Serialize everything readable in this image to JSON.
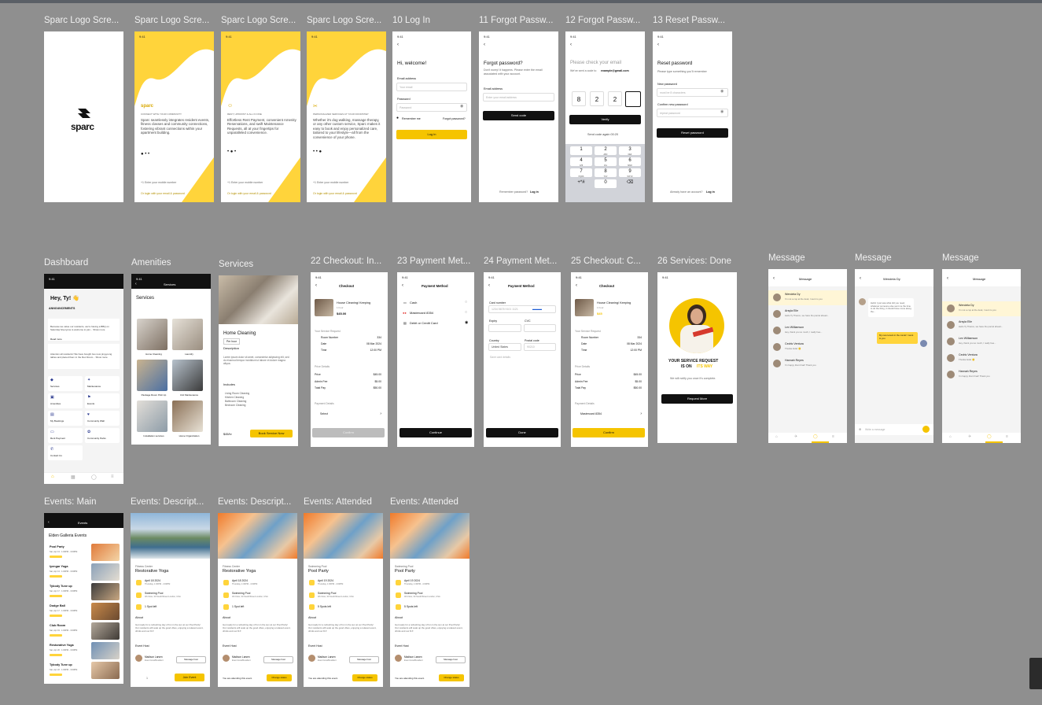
{
  "frames": {
    "splash": {
      "label": "Sparc Logo Scre...",
      "logo": "sparc"
    },
    "onboard1": {
      "label": "Sparc Logo Scre...",
      "brand": "sparc",
      "kicker": "CONNECT WITH YOUR COMMUNITY",
      "text": "Sparc seamlessly integrates resident events, fitness classes and community connections, fostering vibrant connections within your apartment building.",
      "phone": "+1  Enter your mobile number",
      "alt": "Or login with your email & password"
    },
    "onboard2": {
      "label": "Sparc Logo Scre...",
      "kicker": "RENT, UPFRONT & ALL IN ONE",
      "text": "Effortless Rent Payment, convenient Amenity Reservations, and swift Maintenance Requests, all at your fingertips for unparalleled convenience.",
      "phone": "+1  Enter your mobile number",
      "alt": "Or login with your email & password"
    },
    "onboard3": {
      "label": "Sparc Logo Scre...",
      "kicker": "PERSONALIZED SERVICES AT YOUR DOORSTEP",
      "text": "Whether it's dog walking, massage therapy, or any other custom service, Sparc makes it easy to book and enjoy personalized care, tailored to your lifestyle—all from the convenience of your phone.",
      "phone": "+1  Enter your mobile number",
      "alt": "Or login with your email & password"
    },
    "login": {
      "label": "10 Log In",
      "title": "Hi, welcome!",
      "email_label": "Email address",
      "email_ph": "Your email",
      "pw_label": "Password",
      "pw_ph": "Password",
      "remember": "Remember me",
      "forgot": "Forgot password?",
      "button": "Log in"
    },
    "forgot1": {
      "label": "11 Forgot Passw...",
      "title": "Forgot password?",
      "sub": "Don't worry! It happens. Please enter the email associated with your account.",
      "email_label": "Email address",
      "email_ph": "Enter your email address",
      "button": "Send code",
      "footer": "Remember password?",
      "footer_link": "Log in"
    },
    "forgot2": {
      "label": "12 Forgot Passw...",
      "title": "Please check your email",
      "sub": "We've sent a code to",
      "email": "example@gmail.com",
      "digits": [
        "8",
        "2",
        "2",
        ""
      ],
      "button": "Verify",
      "resend": "Send code again  00:20",
      "keys": [
        [
          "1",
          ""
        ],
        [
          "2",
          "ABC"
        ],
        [
          "3",
          "DEF"
        ],
        [
          "4",
          "GHI"
        ],
        [
          "5",
          "JKL"
        ],
        [
          "6",
          "MNO"
        ],
        [
          "7",
          "PQRS"
        ],
        [
          "8",
          "TUV"
        ],
        [
          "9",
          "WXYZ"
        ],
        [
          "+*#",
          ""
        ],
        [
          "0",
          ""
        ],
        [
          "⌫",
          ""
        ]
      ]
    },
    "reset": {
      "label": "13 Reset Passw...",
      "title": "Reset password",
      "sub": "Please type something you'll remember",
      "new_label": "New password",
      "new_ph": "must be 8 characters",
      "confirm_label": "Confirm new password",
      "confirm_ph": "repeat password",
      "button": "Reset password",
      "footer": "Already have an account?",
      "footer_link": "Log in"
    },
    "dashboard": {
      "label": "Dashboard",
      "greeting": "Hey, Ty! 👋",
      "section": "ANNOUNCEMENTS",
      "post1": "Because we value our residents, we're having a BBQ on Saturday! Everyone is welcome to join... Show more",
      "post1_tag": "Read more",
      "post2": "Attention all residents! We have bought two new ping-pong tables and placed them in the Rec Room... Show more",
      "tiles": [
        "Services",
        "Maintenance",
        "Amenities",
        "Events",
        "My Bookings",
        "Community Wall",
        "Rent Payment",
        "Community Perks",
        "Contact Us"
      ]
    },
    "amenities": {
      "label": "Amenities",
      "header": "Services",
      "title": "Services",
      "items": [
        "Home Cleaning",
        "Laundry",
        "Package Room Pick Up",
        "Unit Maintenance",
        "Installation services",
        "Home Organization"
      ]
    },
    "services": {
      "label": "Services",
      "title": "Home Cleaning",
      "chip": "Per hour",
      "desc_h": "Description",
      "desc": "Lorem ipsum dolor sit amet, consectetur adipiscing elit, sed do eiusmod tempor incididunt ut labore et dolore magna aliqua.",
      "incl_h": "Includes",
      "incl": [
        "Living Room Cleaning",
        "Kitchen Cleaning",
        "Bathroom Cleaning",
        "Bedroom Cleaning"
      ],
      "price": "$45/hr",
      "button": "Book Service Now"
    },
    "checkout1": {
      "label": "22 Checkout: In...",
      "title": "Checkout",
      "item": "House Cleaning/ Keeping",
      "item_sub": "1 hour",
      "price": "$45.00",
      "req": "Your Service Request",
      "rows": [
        [
          "Room Number",
          "334"
        ],
        [
          "Date",
          "08 Mar 2024"
        ],
        [
          "Time",
          "12:00 PM"
        ]
      ],
      "pd": "Price Details",
      "prices": [
        [
          "Price",
          "$45.00"
        ],
        [
          "Admin Fee",
          "$5.00"
        ],
        [
          "Total Pay",
          "$50.00"
        ]
      ],
      "pay_h": "Payment Details",
      "pay": "Select",
      "button": "Confirm"
    },
    "payment1": {
      "label": "23 Payment Met...",
      "title": "Payment Method",
      "opts": [
        "Cash",
        "Mastercard 8354",
        "Debit or Credit Card"
      ],
      "button": "Continue"
    },
    "payment2": {
      "label": "24 Payment Met...",
      "title": "Payment Method",
      "card_label": "Card number",
      "card_ph": "1234 5678 9101 1121",
      "exp": "Expiry",
      "cvc": "CVC",
      "country": "Country",
      "country_val": "United States",
      "zip": "Postal code",
      "zip_ph": "90210",
      "save": "Save card details",
      "button": "Done"
    },
    "checkout2": {
      "label": "25 Checkout: C...",
      "title": "Checkout",
      "item": "House Cleaning/ Keeping",
      "item_sub": "1 hour",
      "price": "$45",
      "req": "Your Service Request",
      "rows": [
        [
          "Room Number",
          "334"
        ],
        [
          "Date",
          "08 Mar 2024"
        ],
        [
          "Time",
          "12:00 PM"
        ]
      ],
      "pd": "Price Details",
      "prices": [
        [
          "Price",
          "$45.00"
        ],
        [
          "Admin Fee",
          "$5.00"
        ],
        [
          "Total Pay",
          "$50.00"
        ]
      ],
      "pay_h": "Payment Details",
      "pay": "Mastercard 8354",
      "button": "Confirm"
    },
    "done": {
      "label": "26 Services: Done",
      "line1": "YOUR SERVICE REQUEST",
      "line2a": "IS ON ",
      "line2b": "ITS WAY",
      "sub": "We will notify you once it's complete.",
      "button": "Request More"
    },
    "msg1": {
      "label": "Message",
      "title": "Message",
      "threads": [
        [
          "Wendela Dy",
          "I'm not a cop at the desk, I went to you"
        ],
        [
          "Arsyla Elle",
          "Hello Ty Thanco, we have the parcel ahead..."
        ],
        [
          "Lex Williamson",
          "Hey, thank you so much, I really hea..."
        ],
        [
          "Cedric Ventura",
          "Thanks Aida! 🙂"
        ],
        [
          "Hannah Reyes",
          "I'm happy that it had! Thank you"
        ]
      ]
    },
    "msg2": {
      "label": "Message",
      "title": "Wendela Dy",
      "in": "Hello! I just saw what did you need, whatever someone else sent me the time to do the thing, it should have come along the...",
      "out": "My new tenant in the condo! I went to you",
      "input_ph": "Write a message"
    },
    "msg3": {
      "label": "Message",
      "title": "Message",
      "threads": [
        [
          "Wendela Dy",
          "I'm not a cop at the desk, I went to you"
        ],
        [
          "Arsyla Elle",
          "Hello Ty Thanco, we have the parcel ahead..."
        ],
        [
          "Lex Williamson",
          "Hey, thank you so much, I really hea..."
        ],
        [
          "Cedric Ventura",
          "Thanks Aida! 🙂"
        ],
        [
          "Hannah Reyes",
          "I'm happy that it had! Thank you"
        ]
      ]
    },
    "events": {
      "label": "Events: Main",
      "title": "Events",
      "h": "Elden Galleria Events",
      "list": [
        [
          "Pool Party",
          "Sat, Apr 13 · 1:00PM - 3:00PM"
        ],
        [
          "Iyengar Yoga",
          "Sat, Apr 13 · 1:00PM - 3:00PM"
        ],
        [
          "Tybody Tune up",
          "Sat, Apr 17 · 1:00PM - 3:00PM"
        ],
        [
          "Dodge Ball",
          "Sat, Apr 17 · 1:00PM - 3:00PM"
        ],
        [
          "Club Room",
          "Sat, Apr 19 · 1:00PM - 3:00PM"
        ],
        [
          "Restorative Yoga",
          "Sat, Apr 20 · 1:00PM - 3:00PM"
        ],
        [
          "Tybody Tune up",
          "Sat, Apr 22 · 1:00PM - 3:00PM"
        ]
      ]
    },
    "ev1": {
      "label": "Events: Descript...",
      "venue": "Fitness Center",
      "title": "Restorative Yoga",
      "date": "April 18 2024",
      "date_sub": "Thursday, 1:00PM - 4:00PM",
      "place": "Swimming Pool",
      "place_sub": "4th Floor, 30 South/Street London, USA",
      "spots": "1 Spot left",
      "about_h": "About",
      "about": "Get ready for a refreshing day of fun in the sun at our Pool Party! Our residents will soak up the good vibes, enjoying a relaxed event, drinks and our DJ!",
      "host_h": "Event Host",
      "host": "Madison Larsen",
      "host_sub": "Event Host/Resident",
      "msg": "Message host",
      "stepper": "1",
      "button": "Join Event"
    },
    "ev2": {
      "label": "Events: Descript...",
      "venue": "Fitness Center",
      "title": "Restorative Yoga",
      "date": "April 18 2024",
      "date_sub": "Thursday, 1:00PM - 4:00PM",
      "place": "Swimming Pool",
      "place_sub": "4th Floor, 30 South/Street London, USA",
      "spots": "1 Spot left",
      "about_h": "About",
      "about": "Get ready for a refreshing day of fun in the sun at our Pool Party! Our residents will soak up the good vibes, enjoying a relaxed event, drinks and our DJ!",
      "host_h": "Event Host",
      "host": "Madison Larsen",
      "host_sub": "Event Host/Resident",
      "msg": "Message host",
      "attending": "You are attending this event.",
      "button": "Change status"
    },
    "ev3": {
      "label": "Events: Attended",
      "venue": "Swimming Pool",
      "title": "Pool Party",
      "date": "April 19 2024",
      "date_sub": "Thursday, 1:00PM - 4:00PM",
      "place": "Swimming Pool",
      "place_sub": "4th Floor, 30 South/Street London, USA",
      "spots": "5 Spots left",
      "about_h": "About",
      "about": "Get ready for a refreshing day of fun in the sun at our Pool Party! Our residents will soak up the good vibes, enjoying a relaxed event, drinks and our DJ!",
      "host_h": "Event Host",
      "host": "Madison Larsen",
      "host_sub": "Event Host/Resident",
      "msg": "Message host",
      "attending": "You are attending this event.",
      "button": "Change status"
    },
    "ev4": {
      "label": "Events: Attended",
      "venue": "Swimming Pool",
      "title": "Pool Party",
      "date": "April 19 2024",
      "date_sub": "Thursday, 1:00PM - 4:00PM",
      "place": "Swimming Pool",
      "place_sub": "4th Floor, 30 South/Street London, USA",
      "spots": "5 Spots left",
      "about_h": "About",
      "about": "Get ready for a refreshing day of fun in the sun at our Pool Party! Our residents will soak up the good vibes, enjoying a relaxed event, drinks and our DJ!",
      "host_h": "Event Host",
      "host": "Madison Larsen",
      "host_sub": "Event Host/Resident",
      "msg": "Message host",
      "attending": "You are attending this event.",
      "button": "Change status"
    }
  },
  "status_time": "9:41",
  "colors": {
    "canvas": "#8f8f8f",
    "accent": "#ffd43b",
    "button": "#f5c400",
    "dark": "#111111"
  }
}
